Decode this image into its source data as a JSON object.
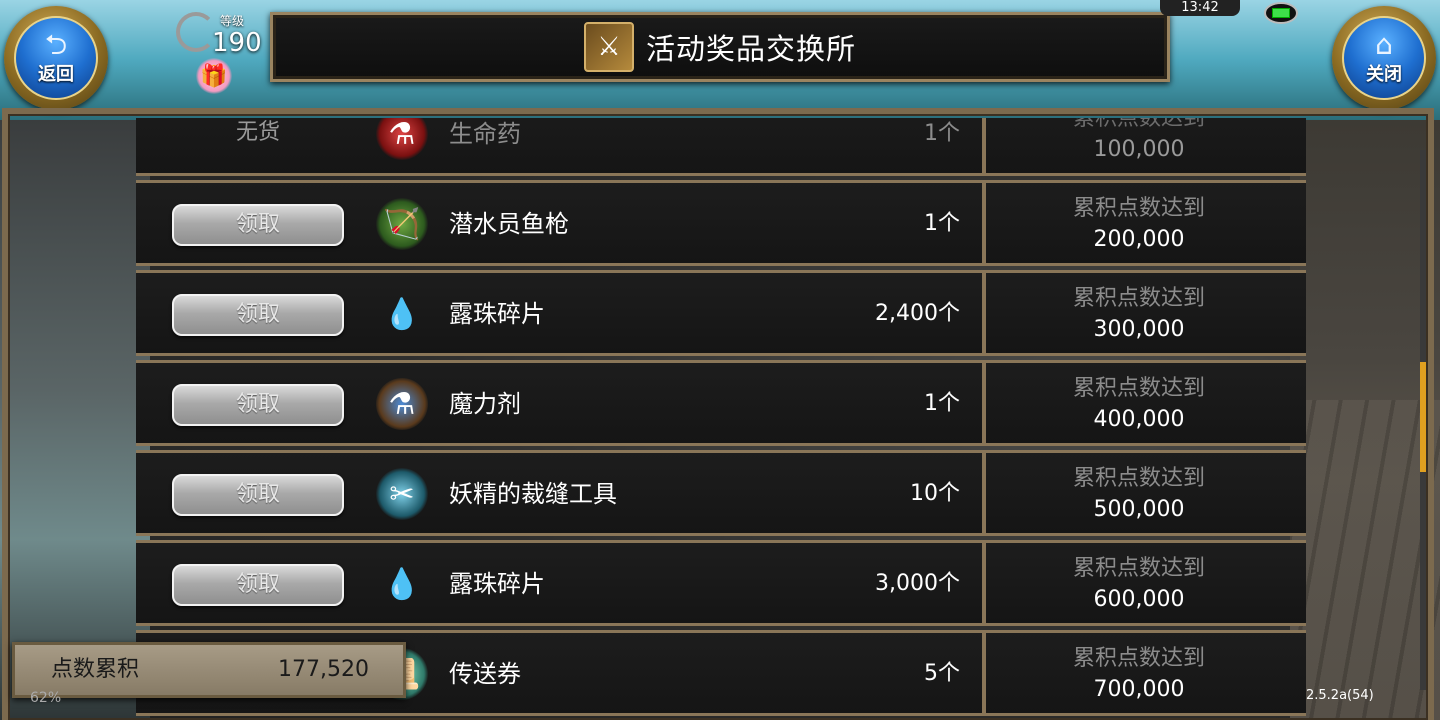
{
  "header": {
    "back_label": "返回",
    "close_label": "关闭",
    "level_label": "等级",
    "level_value": "190",
    "title": "活动奖品交换所",
    "clock": "13:42"
  },
  "rows": [
    {
      "status": "无货",
      "button": "",
      "name": "生命药",
      "qty": "1个",
      "req_label": "累积点数达到",
      "req_value": "100,000",
      "icon": "red-potion-icon"
    },
    {
      "status": "",
      "button": "领取",
      "name": "潜水员鱼枪",
      "qty": "1个",
      "req_label": "累积点数达到",
      "req_value": "200,000",
      "icon": "crossbow-icon"
    },
    {
      "status": "",
      "button": "领取",
      "name": "露珠碎片",
      "qty": "2,400个",
      "req_label": "累积点数达到",
      "req_value": "300,000",
      "icon": "dew-drops-icon"
    },
    {
      "status": "",
      "button": "领取",
      "name": "魔力剂",
      "qty": "1个",
      "req_label": "累积点数达到",
      "req_value": "400,000",
      "icon": "blue-potion-icon"
    },
    {
      "status": "",
      "button": "领取",
      "name": "妖精的裁缝工具",
      "qty": "10个",
      "req_label": "累积点数达到",
      "req_value": "500,000",
      "icon": "scissors-icon"
    },
    {
      "status": "",
      "button": "领取",
      "name": "露珠碎片",
      "qty": "3,000个",
      "req_label": "累积点数达到",
      "req_value": "600,000",
      "icon": "dew-drops-icon"
    },
    {
      "status": "",
      "button": "",
      "name": "传送券",
      "qty": "5个",
      "req_label": "累积点数达到",
      "req_value": "700,000",
      "icon": "teleport-ticket-icon"
    }
  ],
  "footer": {
    "points_label": "点数累积",
    "points_value": "177,520",
    "loading": "62%",
    "version": "2.5.2a(54)"
  },
  "colors": {
    "frame": "#8a7658",
    "accent_gold": "#e0a020",
    "button_blue": "#1f6fd0"
  }
}
